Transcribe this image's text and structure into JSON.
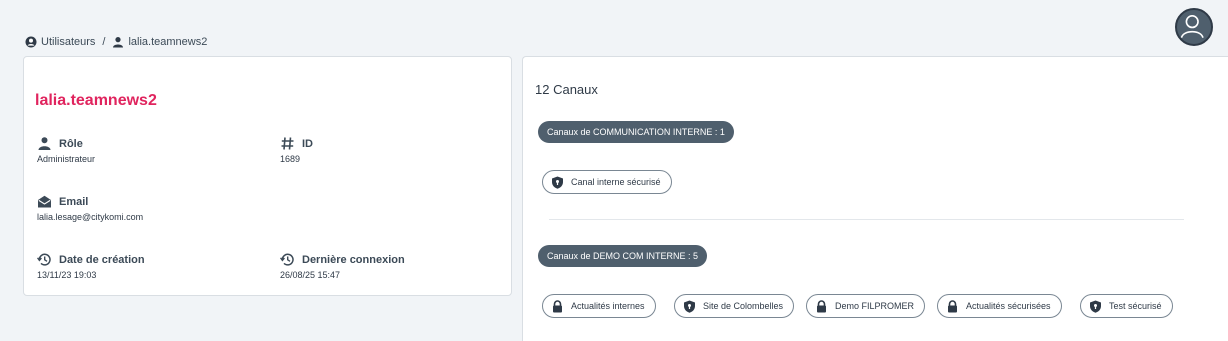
{
  "header": {
    "user_avatar_icon": "user-avatar-icon"
  },
  "breadcrumb": {
    "root_label": "Utilisateurs",
    "root_icon": "users-circle-icon",
    "separator": "/",
    "current_label": "lalia.teamnews2",
    "current_icon": "person-icon"
  },
  "user": {
    "username": "lalia.teamnews2",
    "role_label": "Rôle",
    "role_value": "Administrateur",
    "id_label": "ID",
    "id_value": "1689",
    "email_label": "Email",
    "email_value": "lalia.lesage@citykomi.com",
    "created_label": "Date de création",
    "created_value": "13/11/23 19:03",
    "last_login_label": "Dernière connexion",
    "last_login_value": "26/08/25 15:47"
  },
  "channels": {
    "count_label": "12 Canaux",
    "groups": [
      {
        "title": "Canaux de COMMUNICATION INTERNE : 1",
        "items": [
          {
            "label": "Canal interne sécurisé",
            "icon": "shield-lock-icon"
          }
        ]
      },
      {
        "title": "Canaux de DEMO COM INTERNE : 5",
        "items": [
          {
            "label": "Actualités internes",
            "icon": "lock-icon"
          },
          {
            "label": "Site de Colombelles",
            "icon": "shield-lock-icon"
          },
          {
            "label": "Demo FILPROMER",
            "icon": "lock-icon"
          },
          {
            "label": "Actualités sécurisées",
            "icon": "lock-icon"
          },
          {
            "label": "Test sécurisé",
            "icon": "shield-lock-icon"
          }
        ]
      }
    ]
  },
  "colors": {
    "accent": "#e0245e",
    "badge": "#4f5f6d",
    "background": "#f1f4f7"
  }
}
